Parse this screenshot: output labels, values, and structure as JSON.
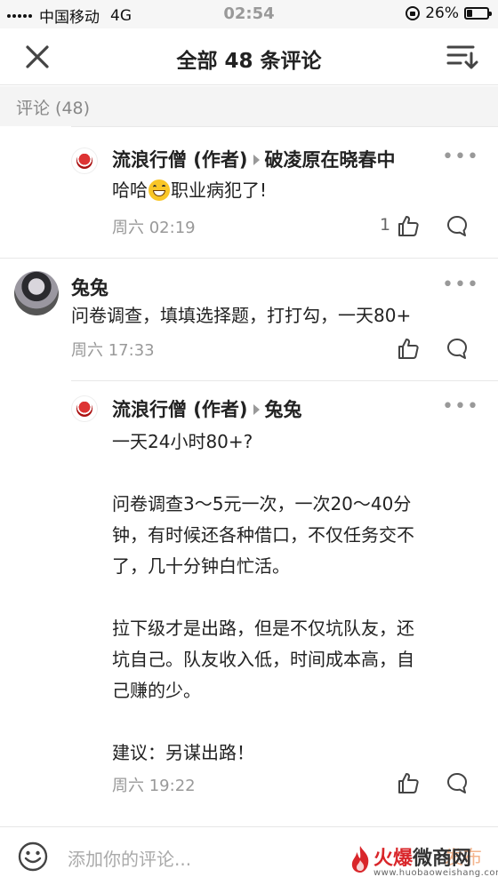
{
  "status_bar": {
    "carrier": "中国移动",
    "network": "4G",
    "time": "02:54",
    "battery": "26%",
    "battery_level": 0.26
  },
  "header": {
    "title": "全部 48 条评论"
  },
  "section_label": "评论 (48)",
  "comments": [
    {
      "author": "流浪行僧 (作者)",
      "reply_to": "破凌原在晓春中",
      "text_before_emoji": "哈哈",
      "text_after_emoji": "职业病犯了!",
      "time": "周六 02:19",
      "likes": "1"
    },
    {
      "author": "兔兔",
      "lines": [
        "问卷调查，填填选择题，打打勾，一天80+"
      ],
      "time": "周六 17:33",
      "likes": ""
    },
    {
      "author": "流浪行僧 (作者)",
      "reply_to": "兔兔",
      "lines": [
        "一天24小时80+?",
        "",
        "问卷调查3～5元一次，一次20～40分",
        "钟，有时候还各种借口，不仅任务交不",
        "了，几十分钟白忙活。",
        "",
        "拉下级才是出路，但是不仅坑队友，还",
        "坑自己。队友收入低，时间成本高，自",
        "己赚的少。",
        "",
        "建议：另谋出路！"
      ],
      "time": "周六 19:22",
      "likes": ""
    }
  ],
  "more_label": "•••",
  "bottom_bar": {
    "placeholder": "添加你的评论...",
    "send": "发布"
  },
  "watermark": {
    "brand_red": "火爆",
    "brand_dark": "微商网",
    "url": "www.huobaoweishang.com"
  },
  "icons": [
    "close-icon",
    "sort-icon",
    "like-icon",
    "comment-icon",
    "more-icon",
    "emoji-icon",
    "grin-emoji"
  ],
  "colors": {
    "accent": "#f3b48c",
    "watermark_red": "#d9262a",
    "muted": "#999999"
  }
}
